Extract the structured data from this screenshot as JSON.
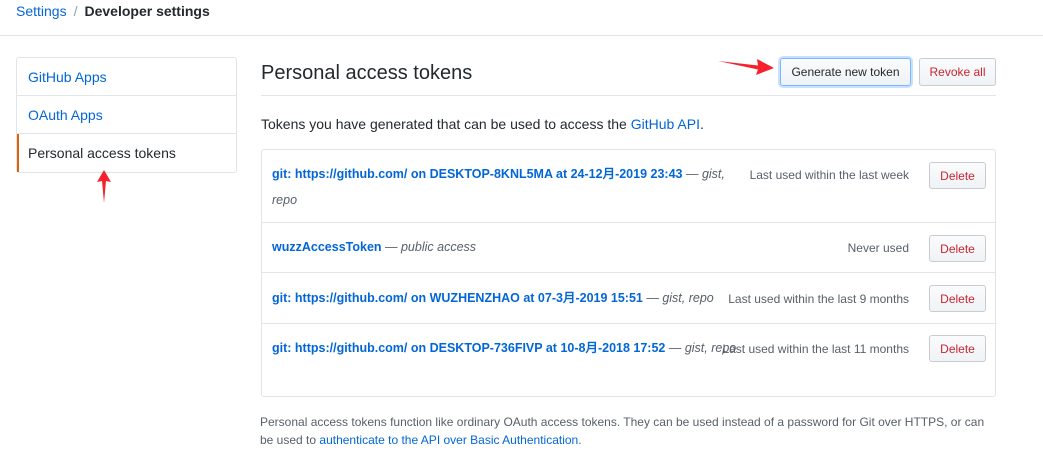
{
  "breadcrumb": {
    "root": "Settings",
    "separator": "/",
    "current": "Developer settings"
  },
  "sidebar": {
    "items": [
      {
        "label": "GitHub Apps",
        "selected": false
      },
      {
        "label": "OAuth Apps",
        "selected": false
      },
      {
        "label": "Personal access tokens",
        "selected": true
      }
    ]
  },
  "main": {
    "title": "Personal access tokens",
    "generate_button": "Generate new token",
    "revoke_all_button": "Revoke all",
    "intro_text": "Tokens you have generated that can be used to access the ",
    "intro_link": "GitHub API",
    "intro_end": ".",
    "tokens": [
      {
        "name": "git: https://github.com/ on DESKTOP-8KNL5MA at 24-12月-2019 23:43",
        "sep": " — ",
        "scopes": "gist, repo",
        "last_used": "Last used within the last week",
        "delete": "Delete"
      },
      {
        "name": "wuzzAccessToken",
        "sep": " — ",
        "scopes": "public access",
        "last_used": "Never used",
        "delete": "Delete"
      },
      {
        "name": "git: https://github.com/ on WUZHENZHAO at 07-3月-2019 15:51",
        "sep": " — ",
        "scopes": "gist, repo",
        "last_used": "Last used within the last 9 months",
        "delete": "Delete"
      },
      {
        "name": "git: https://github.com/ on DESKTOP-736FIVP at 10-8月-2018 17:52",
        "sep": " — ",
        "scopes": "gist, repo",
        "last_used": "Last used within the last 11 months",
        "delete": "Delete"
      }
    ],
    "footer_text": "Personal access tokens function like ordinary OAuth access tokens. They can be used instead of a password for Git over HTTPS, or can be used to ",
    "footer_link": "authenticate to the API over Basic Authentication",
    "footer_end": "."
  },
  "colors": {
    "link": "#0366d6",
    "danger": "#cb2431",
    "selected_border": "#e36209",
    "annotation_arrow": "#f5222d"
  }
}
